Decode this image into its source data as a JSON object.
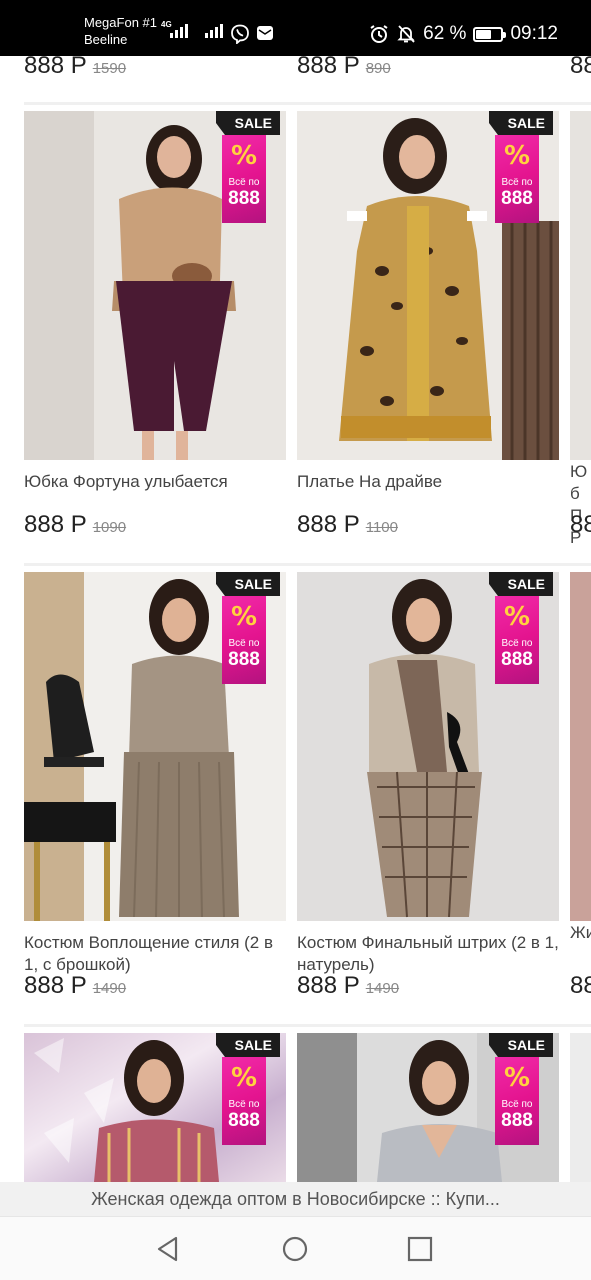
{
  "status_bar": {
    "carrier_1": "MegaFon #1",
    "carrier_2": "Beeline",
    "network_tag": "4G",
    "battery": "62 %",
    "battery_level": 0.62,
    "time": "09:12",
    "icons": [
      "signal-icon",
      "viber-icon",
      "mail-icon",
      "alarm-icon",
      "silent-icon",
      "battery-icon"
    ]
  },
  "top_row_prices": [
    {
      "price": "888 Р",
      "old": "1590"
    },
    {
      "price": "888 Р",
      "old": "890"
    },
    {
      "price": "88",
      "old": ""
    }
  ],
  "badge": {
    "ribbon": "SALE",
    "percent": "%",
    "line1": "Всё по",
    "line2": "888"
  },
  "products": [
    {
      "name": "Юбка Фортуна улыбается",
      "price": "888 Р",
      "old": "1090"
    },
    {
      "name": "Платье На драйве",
      "price": "888 Р",
      "old": "1100"
    },
    {
      "name": "Костюм Воплощение стиля (2 в 1, с брошкой)",
      "price": "888 Р",
      "old": "1490"
    },
    {
      "name": "Костюм Финальный штрих (2 в 1, натурель)",
      "price": "888 Р",
      "old": "1490"
    }
  ],
  "peek_column": {
    "row1_name": "Юб ПР",
    "row1_price": "88",
    "row2_name": "Жи",
    "row2_price": "88"
  },
  "page_title": "Женская одежда оптом в Новосибирске :: Купи...",
  "nav": {
    "back": "back-icon",
    "home": "home-icon",
    "recents": "recents-icon"
  }
}
